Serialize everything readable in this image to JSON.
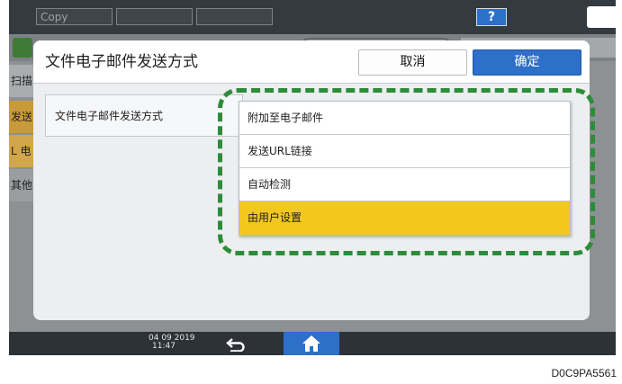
{
  "topbar": {
    "tab_copy": "Copy",
    "help_label": "?"
  },
  "left_menu": [
    "扫描",
    "发送",
    "L 电",
    "其他"
  ],
  "dialog": {
    "title": "文件电子邮件发送方式",
    "cancel_label": "取消",
    "ok_label": "确定",
    "setting_label": "文件电子邮件发送方式",
    "options": [
      "附加至电子邮件",
      "发送URL链接",
      "自动检测",
      "由用户设置"
    ],
    "selected_option": "由用户设置"
  },
  "status_bar": {
    "date": "04 09 2019",
    "time": "11:47"
  },
  "icons": {
    "moon": "moon-icon",
    "back": "back-arrow-icon",
    "home": "home-icon"
  },
  "colors": {
    "accent_blue": "#2e6fc9",
    "selected_yellow": "#f2c81f",
    "highlight_green": "#2d8c3a"
  },
  "figure_id": "D0C9PA5561"
}
